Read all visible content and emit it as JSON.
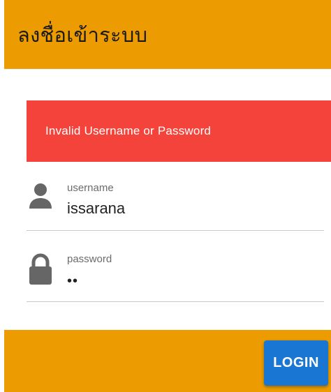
{
  "header": {
    "title": "ลงชื่อเข้าระบบ"
  },
  "error": {
    "message": "Invalid Username or Password"
  },
  "fields": {
    "username": {
      "label": "username",
      "value": "issarana",
      "icon": "person-icon"
    },
    "password": {
      "label": "password",
      "value": "••",
      "icon": "lock-icon"
    }
  },
  "footer": {
    "login_label": "LOGIN"
  },
  "colors": {
    "header_bg": "#ec9c00",
    "error_bg": "#f4433a",
    "button_bg": "#1976d2",
    "icon": "#666666"
  }
}
